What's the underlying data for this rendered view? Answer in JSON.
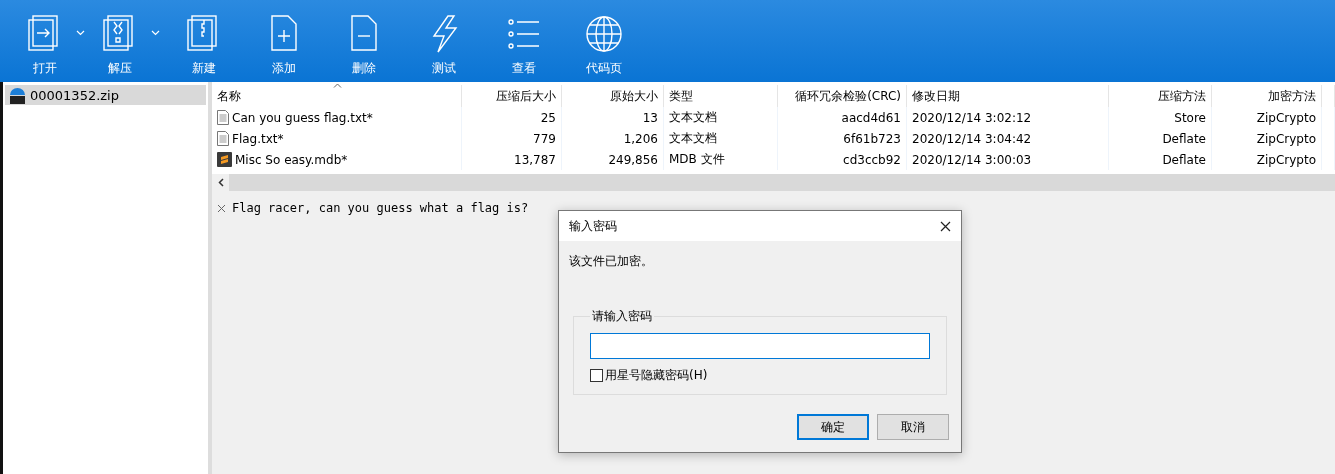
{
  "toolbar": {
    "tools": [
      {
        "kind": "open",
        "label": "打开",
        "dropdown": true
      },
      {
        "kind": "extract",
        "label": "解压",
        "dropdown": true
      },
      {
        "kind": "new",
        "label": "新建",
        "dropdown": false
      },
      {
        "kind": "add",
        "label": "添加",
        "dropdown": false
      },
      {
        "kind": "delete",
        "label": "删除",
        "dropdown": false
      },
      {
        "kind": "test",
        "label": "测试",
        "dropdown": false
      },
      {
        "kind": "view",
        "label": "查看",
        "dropdown": false
      },
      {
        "kind": "codepage",
        "label": "代码页",
        "dropdown": false
      }
    ]
  },
  "sidebar": {
    "items": [
      {
        "label": "00001352.zip",
        "selected": true
      }
    ]
  },
  "table": {
    "columns": [
      {
        "label": "名称",
        "sorted": true
      },
      {
        "label": "压缩后大小",
        "sorted": false
      },
      {
        "label": "原始大小",
        "sorted": false
      },
      {
        "label": "类型",
        "sorted": false
      },
      {
        "label": "循环冗余检验(CRC)",
        "sorted": false
      },
      {
        "label": "修改日期",
        "sorted": false
      },
      {
        "label": "压缩方法",
        "sorted": false
      },
      {
        "label": "加密方法",
        "sorted": false
      }
    ],
    "rows": [
      {
        "kind": "text",
        "cells": [
          "Can you guess flag.txt*",
          "25",
          "13",
          "文本文档",
          "aacd4d61",
          "2020/12/14 3:02:12",
          "Store",
          "ZipCrypto"
        ]
      },
      {
        "kind": "text",
        "cells": [
          "Flag.txt*",
          "779",
          "1,206",
          "文本文档",
          "6f61b723",
          "2020/12/14 3:04:42",
          "Deflate",
          "ZipCrypto"
        ]
      },
      {
        "kind": "mdb",
        "cells": [
          "Misc So easy.mdb*",
          "13,787",
          "249,856",
          "MDB 文件",
          "cd3ccb92",
          "2020/12/14 3:00:03",
          "Deflate",
          "ZipCrypto"
        ]
      }
    ]
  },
  "comment": {
    "text": "Flag racer, can you guess what a flag is?"
  },
  "dialog": {
    "title": "输入密码",
    "message": "该文件已加密。",
    "group_label": "请输入密码",
    "hide_password": {
      "label": "用星号隐藏密码(H)",
      "checked": false
    },
    "buttons": [
      {
        "label": "确定",
        "default": true
      },
      {
        "label": "取消",
        "default": false
      }
    ]
  }
}
